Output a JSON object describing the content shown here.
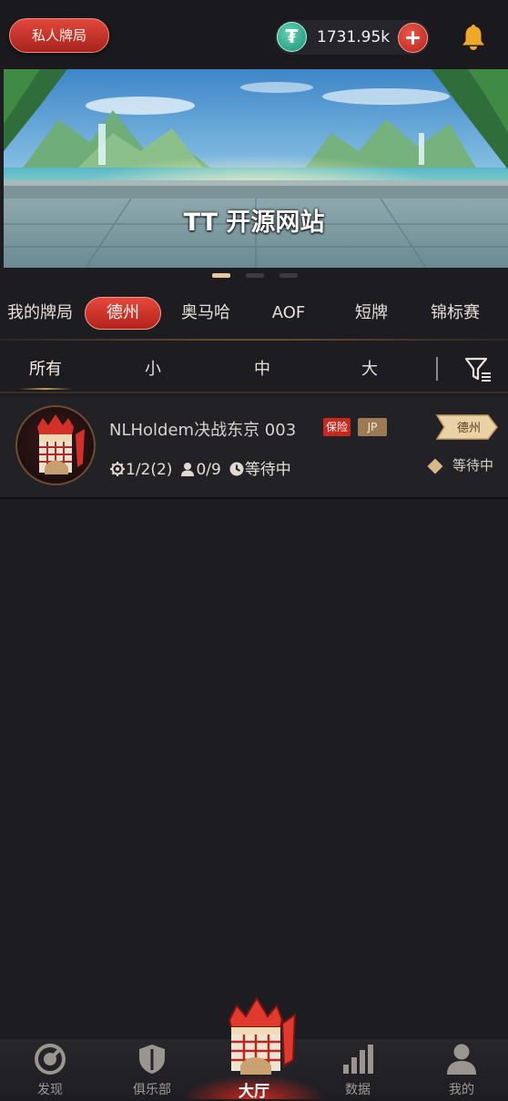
{
  "topbar": {
    "private_label": "私人牌局",
    "balance": "1731.95k",
    "currency_icon": "tether-icon",
    "add_icon": "add-icon",
    "bell_icon": "bell-icon"
  },
  "banner": {
    "caption": "TT 开源网站",
    "slide_count": 3,
    "active_slide": 1
  },
  "game_tabs": [
    "我的牌局",
    "德州",
    "奥马哈",
    "AOF",
    "短牌",
    "锦标赛"
  ],
  "game_tabs_active": "德州",
  "stakes": [
    "所有",
    "小",
    "中",
    "大"
  ],
  "stakes_active": "所有",
  "filter_icon": "filter-icon",
  "room": {
    "name": "NLHoldem决战东京 003",
    "badge_insurance": "保险",
    "badge_jp": "JP",
    "blinds": "1/2(2)",
    "players": "0/9",
    "status": "等待中",
    "type_tag": "德州",
    "right_status": "等待中"
  },
  "nav": {
    "discover": "发现",
    "club": "俱乐部",
    "lobby": "大厅",
    "data": "数据",
    "me": "我的"
  },
  "colors": {
    "accent_red": "#d6352a",
    "gold": "#c39a5a",
    "background": "#1c1c21"
  }
}
